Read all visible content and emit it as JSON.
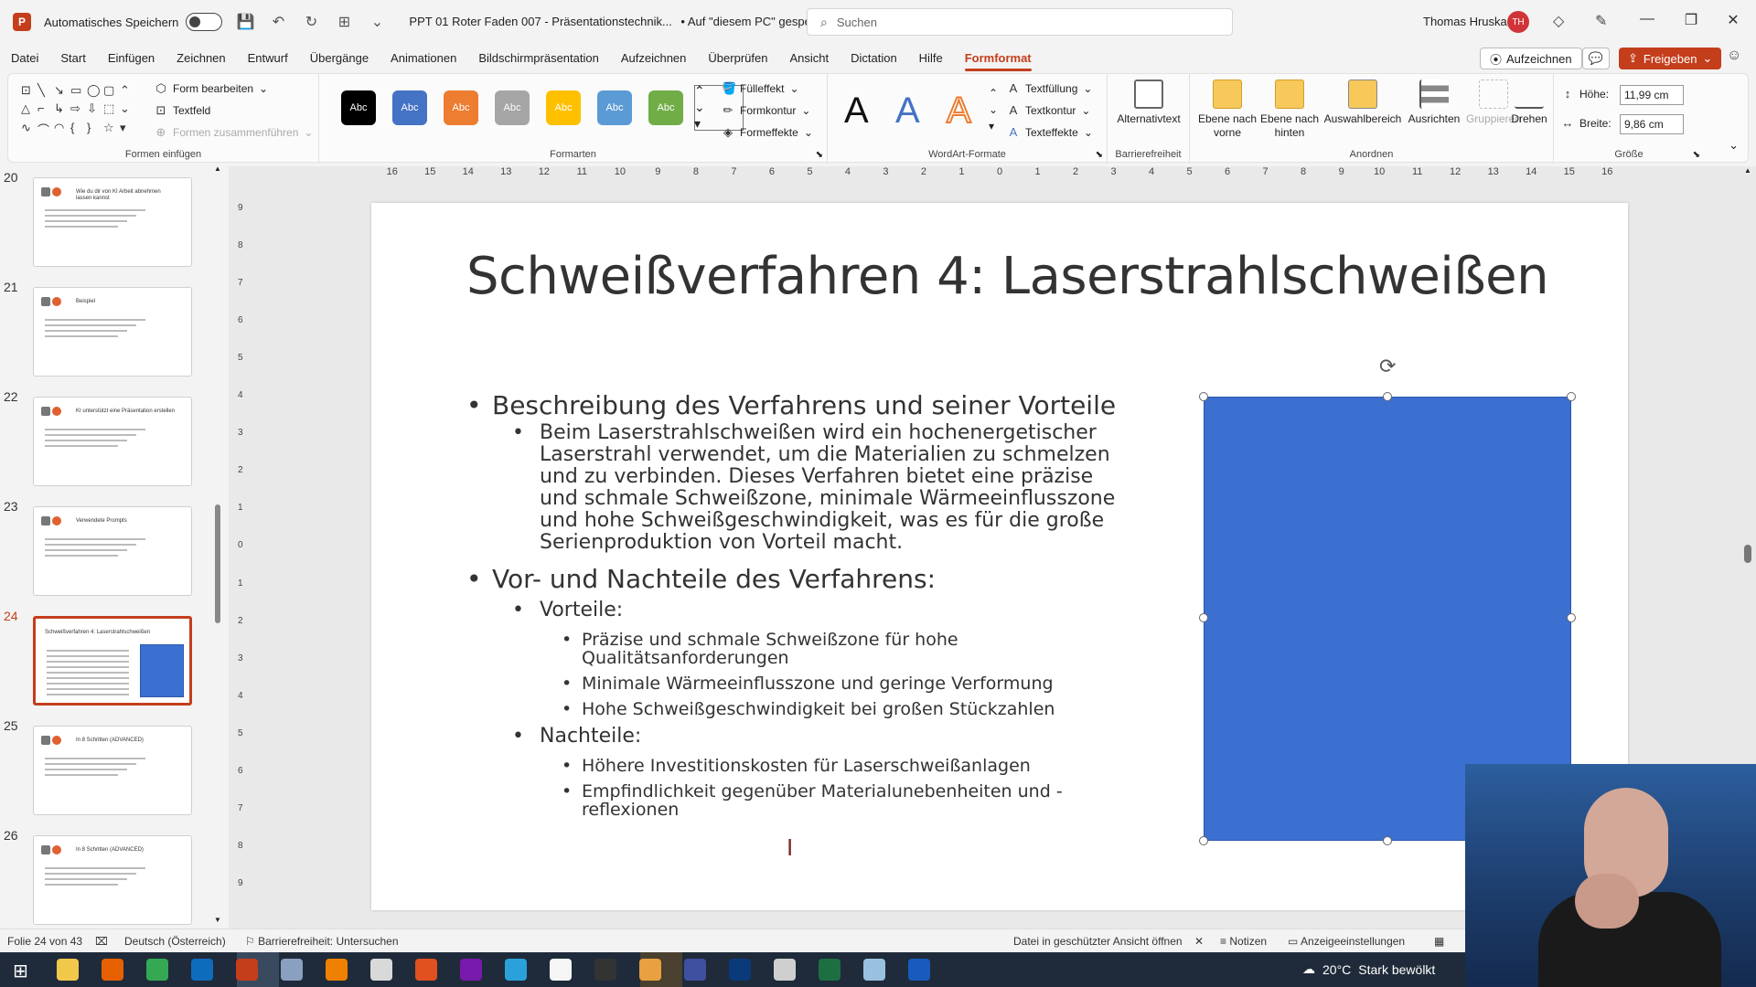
{
  "titlebar": {
    "autosave_label": "Automatisches Speichern",
    "doc_title": "PPT 01 Roter Faden 007 - Präsentationstechnik...",
    "saved_state": "• Auf \"diesem PC\" gespeichert",
    "search_placeholder": "Suchen",
    "user_name": "Thomas Hruska",
    "user_initials": "TH"
  },
  "menu": {
    "items": [
      "Datei",
      "Start",
      "Einfügen",
      "Zeichnen",
      "Entwurf",
      "Übergänge",
      "Animationen",
      "Bildschirmpräsentation",
      "Aufzeichnen",
      "Überprüfen",
      "Ansicht",
      "Dictation",
      "Hilfe",
      "Formformat"
    ],
    "active": "Formformat",
    "record_label": "Aufzeichnen",
    "share_label": "Freigeben"
  },
  "ribbon": {
    "insert_shapes": {
      "edit_shape": "Form bearbeiten",
      "textbox": "Textfeld",
      "merge_shapes": "Formen zusammenführen",
      "label": "Formen einfügen"
    },
    "shape_styles": {
      "swatches": [
        {
          "text": "Abc",
          "color": "#000000"
        },
        {
          "text": "Abc",
          "color": "#4472c4"
        },
        {
          "text": "Abc",
          "color": "#ed7d31"
        },
        {
          "text": "Abc",
          "color": "#a5a5a5"
        },
        {
          "text": "Abc",
          "color": "#ffc000"
        },
        {
          "text": "Abc",
          "color": "#5b9bd5"
        },
        {
          "text": "Abc",
          "color": "#70ad47"
        }
      ],
      "fill": "Fülleffekt",
      "outline": "Formkontur",
      "effects": "Formeffekte",
      "label": "Formarten"
    },
    "wordart": {
      "letter": "A",
      "text_fill": "Textfüllung",
      "text_outline": "Textkontur",
      "text_effects": "Texteffekte",
      "label": "WordArt-Formate"
    },
    "accessibility": {
      "alt_text": "Alternativtext",
      "label": "Barrierefreiheit"
    },
    "arrange": {
      "bring_forward": "Ebene nach vorne",
      "send_backward": "Ebene nach hinten",
      "selection_pane": "Auswahlbereich",
      "align": "Ausrichten",
      "group": "Gruppieren",
      "rotate": "Drehen",
      "label": "Anordnen"
    },
    "size": {
      "height_label": "Höhe:",
      "height_value": "11,99 cm",
      "width_label": "Breite:",
      "width_value": "9,86 cm",
      "label": "Größe"
    }
  },
  "thumbnails": [
    {
      "num": "20",
      "title": "Wie du dir von KI Arbeit abnehmen lassen kannst",
      "selected": false
    },
    {
      "num": "21",
      "title": "Beispiel",
      "selected": false
    },
    {
      "num": "22",
      "title": "KI unterstützt eine Präsentation erstellen",
      "selected": false
    },
    {
      "num": "23",
      "title": "Verwendete Prompts",
      "selected": false
    },
    {
      "num": "24",
      "title": "Schweißverfahren 4: Laserstrahlschweißen",
      "selected": true
    },
    {
      "num": "25",
      "title": "In 8 Schritten (ADVANCED)",
      "selected": false
    },
    {
      "num": "26",
      "title": "In 8 Schritten (ADVANCED)",
      "selected": false
    }
  ],
  "hruler_ticks": [
    "16",
    "15",
    "14",
    "13",
    "12",
    "11",
    "10",
    "9",
    "8",
    "7",
    "6",
    "5",
    "4",
    "3",
    "2",
    "1",
    "0",
    "1",
    "2",
    "3",
    "4",
    "5",
    "6",
    "7",
    "8",
    "9",
    "10",
    "11",
    "12",
    "13",
    "14",
    "15",
    "16"
  ],
  "vruler_ticks": [
    "9",
    "8",
    "7",
    "6",
    "5",
    "4",
    "3",
    "2",
    "1",
    "0",
    "1",
    "2",
    "3",
    "4",
    "5",
    "6",
    "7",
    "8",
    "9"
  ],
  "slide": {
    "title": "Schweißverfahren 4: Laserstrahlschweißen",
    "bullet1": "Beschreibung des Verfahrens und seiner Vorteile",
    "desc": [
      "Beim Laserstrahlschweißen wird ein hochenergetischer",
      "Laserstrahl verwendet, um die Materialien zu schmelzen",
      "und zu verbinden. Dieses Verfahren bietet eine präzise",
      "und schmale Schweißzone, minimale Wärmeeinflusszone",
      "und hohe Schweißgeschwindigkeit, was es für die große",
      "Serienproduktion von Vorteil macht."
    ],
    "bullet2": "Vor- und Nachteile des Verfahrens:",
    "pros_label": "Vorteile:",
    "pros": [
      [
        "Präzise und schmale Schweißzone für hohe",
        "Qualitätsanforderungen"
      ],
      [
        "Minimale Wärmeeinflusszone und geringe Verformung"
      ],
      [
        "Hohe Schweißgeschwindigkeit bei großen Stückzahlen"
      ]
    ],
    "cons_label": "Nachteile:",
    "cons": [
      [
        "Höhere Investitionskosten für Laserschweißanlagen"
      ],
      [
        "Empfindlichkeit gegenüber Materialunebenheiten und -",
        "reflexionen"
      ]
    ],
    "shape_color": "#3b6fd0"
  },
  "status": {
    "slide_info": "Folie 24 von 43",
    "language": "Deutsch (Österreich)",
    "accessibility": "Barrierefreiheit: Untersuchen",
    "protected": "Datei in geschützter Ansicht öffnen",
    "notes": "Notizen",
    "display": "Anzeigeeinstellungen"
  },
  "taskbar": {
    "temperature": "20°C",
    "weather": "Stark bewölkt"
  }
}
